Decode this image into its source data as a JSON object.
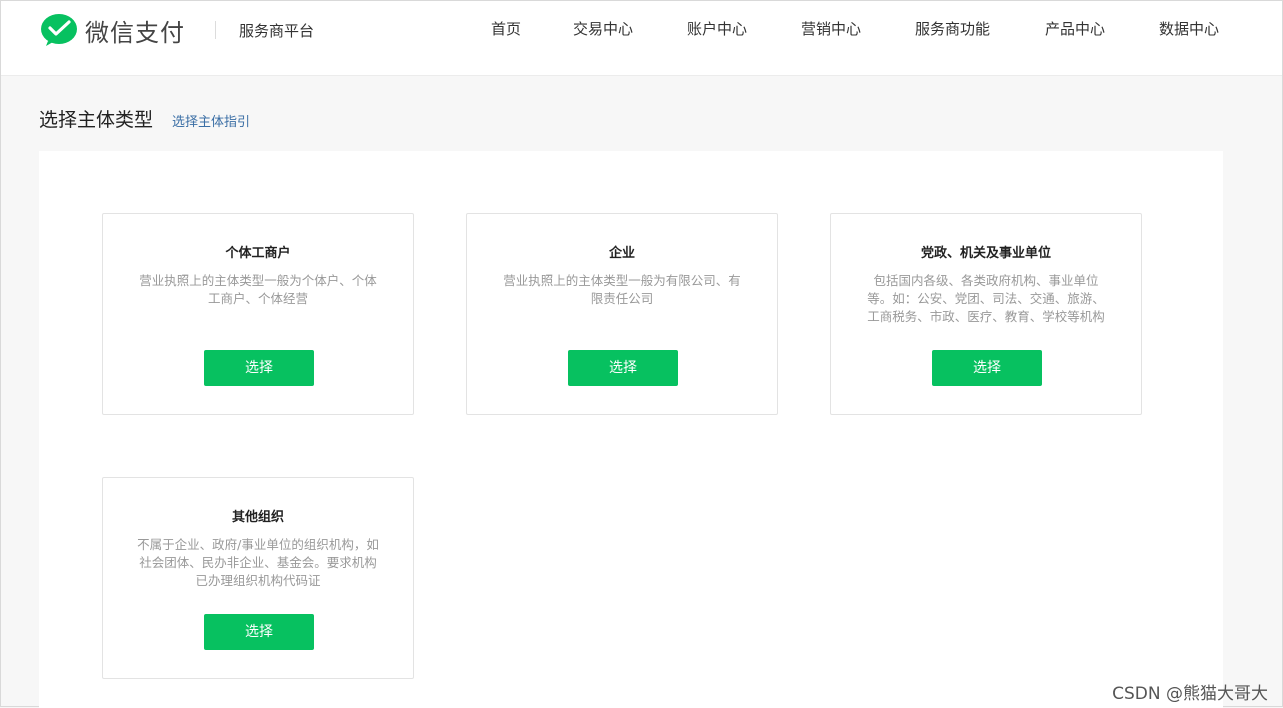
{
  "header": {
    "brand": "微信支付",
    "platform": "服务商平台",
    "nav": [
      "首页",
      "交易中心",
      "账户中心",
      "营销中心",
      "服务商功能",
      "产品中心",
      "数据中心"
    ],
    "logo_icon": "wechat-pay-check-icon",
    "brand_color": "#07c160"
  },
  "main": {
    "title": "选择主体类型",
    "guide_link": "选择主体指引",
    "cards": [
      {
        "title": "个体工商户",
        "desc_lines": [
          "营业执照上的主体类型一般为个体户、个体",
          "工商户、个体经营"
        ],
        "button": "选择"
      },
      {
        "title": "企业",
        "desc_lines": [
          "营业执照上的主体类型一般为有限公司、有",
          "限责任公司"
        ],
        "button": "选择"
      },
      {
        "title": "党政、机关及事业单位",
        "desc_lines": [
          "包括国内各级、各类政府机构、事业单位",
          "等。如：公安、党团、司法、交通、旅游、",
          "工商税务、市政、医疗、教育、学校等机构"
        ],
        "button": "选择"
      },
      {
        "title": "其他组织",
        "desc_lines": [
          "不属于企业、政府/事业单位的组织机构，如",
          "社会团体、民办非企业、基金会。要求机构",
          "已办理组织机构代码证"
        ],
        "button": "选择"
      }
    ]
  },
  "watermark": "CSDN @熊猫大哥大"
}
